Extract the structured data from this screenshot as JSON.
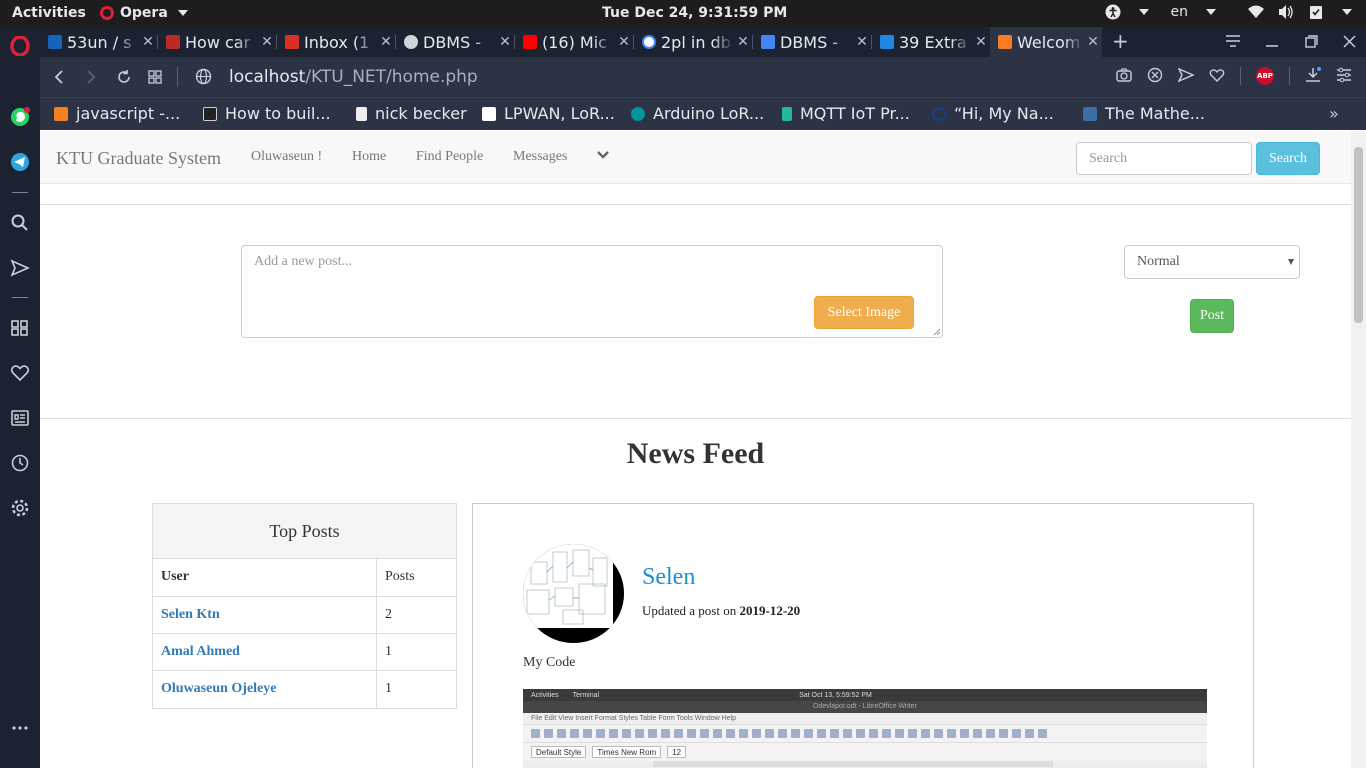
{
  "system": {
    "activities": "Activities",
    "app_name": "Opera",
    "clock": "Tue Dec 24,  9:31:59 PM",
    "language": "en"
  },
  "tabs": [
    {
      "title": "53un / s",
      "favicon_color": "#1565c0"
    },
    {
      "title": "How car",
      "favicon_color": "#b92b27"
    },
    {
      "title": "Inbox (1",
      "favicon_color": "#d93025"
    },
    {
      "title": "DBMS -",
      "favicon_color": "#d0d4db"
    },
    {
      "title": "(16) Mic",
      "favicon_color": "#ff0000"
    },
    {
      "title": "2pl in db",
      "favicon_color": "#4285f4"
    },
    {
      "title": "DBMS -",
      "favicon_color": "#4285f4"
    },
    {
      "title": "39 Extra",
      "favicon_color": "#1e88e5"
    },
    {
      "title": "Welcom",
      "favicon_color": "#fb7a24",
      "active": true
    }
  ],
  "address": {
    "url_host": "localhost",
    "url_path": "/KTU_NET/home.php"
  },
  "bookmarks": [
    {
      "label": "javascript -...",
      "favicon_color": "#f48024"
    },
    {
      "label": "How to buil...",
      "favicon_color": "#222222"
    },
    {
      "label": "nick becker",
      "favicon_color": "#eeeeee"
    },
    {
      "label": "LPWAN, LoR...",
      "favicon_color": "#ffffff"
    },
    {
      "label": "Arduino LoR...",
      "favicon_color": "#00979d"
    },
    {
      "label": "MQTT IoT Pr...",
      "favicon_color": "#22b8a0"
    },
    {
      "label": "“Hi, My Na...",
      "favicon_color": "#1a3d8f"
    },
    {
      "label": "The Mathe...",
      "favicon_color": "#3b6ea5"
    }
  ],
  "site": {
    "brand": "KTU Graduate System",
    "nav": [
      "Oluwaseun !",
      "Home",
      "Find People",
      "Messages"
    ],
    "search_placeholder": "Search",
    "search_button": "Search"
  },
  "composer": {
    "placeholder": "Add a new post...",
    "select_image": "Select Image",
    "privacy_value": "Normal",
    "post_button": "Post"
  },
  "feed": {
    "title": "News Feed",
    "top_posts": {
      "heading": "Top Posts",
      "col_user": "User",
      "col_posts": "Posts",
      "rows": [
        {
          "user": "Selen Ktn",
          "posts": "2"
        },
        {
          "user": "Amal Ahmed",
          "posts": "1"
        },
        {
          "user": "Oluwaseun Ojeleye",
          "posts": "1"
        }
      ]
    },
    "post": {
      "author": "Selen",
      "updated_prefix": "Updated a post on",
      "date": "2019-12-20",
      "body": "My Code",
      "screenshot": {
        "topbar_left": "Activities",
        "app": "Terminal",
        "clock": "Sat Oct 13,  5:59:52 PM",
        "window_title": "Odevlapor.odt - LibreOffice Writer",
        "menu": "File   Edit   View   Insert   Format   Styles   Table   Form   Tools   Window   Help",
        "style": "Default Style",
        "font": "Times New Rom",
        "size": "12"
      }
    }
  },
  "colors": {
    "accent_link": "#337ab7",
    "search_btn": "#5bc0de",
    "select_image_btn": "#f0ad4e",
    "post_btn": "#5cb85c"
  }
}
